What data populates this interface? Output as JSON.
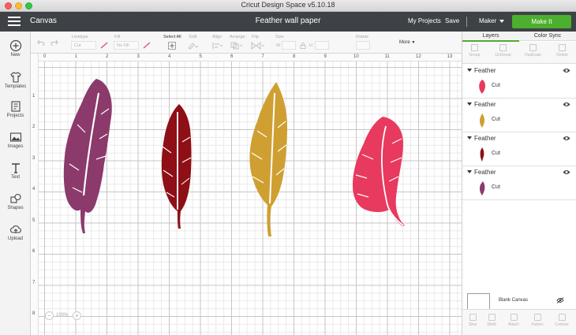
{
  "window": {
    "title": "Cricut Design Space  v5.10.18"
  },
  "header": {
    "canvas_label": "Canvas",
    "document_name": "Feather wall paper",
    "my_projects": "My Projects",
    "save": "Save",
    "machine": "Maker",
    "make_it": "Make It"
  },
  "sidebar": {
    "items": [
      {
        "label": "New",
        "icon": "plus-circle-icon"
      },
      {
        "label": "Templates",
        "icon": "shirt-icon"
      },
      {
        "label": "Projects",
        "icon": "projects-icon"
      },
      {
        "label": "Images",
        "icon": "image-icon"
      },
      {
        "label": "Text",
        "icon": "text-icon"
      },
      {
        "label": "Shapes",
        "icon": "shapes-icon"
      },
      {
        "label": "Upload",
        "icon": "cloud-upload-icon"
      }
    ]
  },
  "toolbar": {
    "linetype_label": "Linetype",
    "linetype_value": "Cut",
    "fill_label": "Fill",
    "fill_value": "No Fill",
    "select_all": "Select All",
    "edit": "Edit",
    "align": "Align",
    "arrange": "Arrange",
    "flip": "Flip",
    "size": "Size",
    "size_w": "W",
    "size_h": "H",
    "rotate": "Rotate",
    "more": "More"
  },
  "canvas": {
    "ruler_top": [
      "0",
      "1",
      "2",
      "3",
      "4",
      "5",
      "6",
      "7",
      "8",
      "9",
      "10",
      "11",
      "12",
      "13"
    ],
    "ruler_left": [
      "1",
      "2",
      "3",
      "4",
      "5",
      "6",
      "7",
      "8"
    ],
    "zoom": "100%",
    "feathers": [
      {
        "name": "purple-feather",
        "color": "#8b3a6b"
      },
      {
        "name": "darkred-feather",
        "color": "#8e0f16"
      },
      {
        "name": "gold-feather",
        "color": "#cf9f32"
      },
      {
        "name": "pink-feather",
        "color": "#e8395f"
      }
    ]
  },
  "panel": {
    "tabs": [
      "Layers",
      "Color Sync"
    ],
    "actions": [
      "Group",
      "UnGroup",
      "Duplicate",
      "Delete"
    ],
    "layers": [
      {
        "group": "Feather",
        "item": "Cut",
        "color": "#e8395f"
      },
      {
        "group": "Feather",
        "item": "Cut",
        "color": "#cf9f32"
      },
      {
        "group": "Feather",
        "item": "Cut",
        "color": "#8e0f16"
      },
      {
        "group": "Feather",
        "item": "Cut",
        "color": "#8b3a6b"
      }
    ],
    "blank_canvas": "Blank Canvas",
    "bottom_actions": [
      "Slice",
      "Weld",
      "Attach",
      "Flatten",
      "Contour"
    ]
  }
}
